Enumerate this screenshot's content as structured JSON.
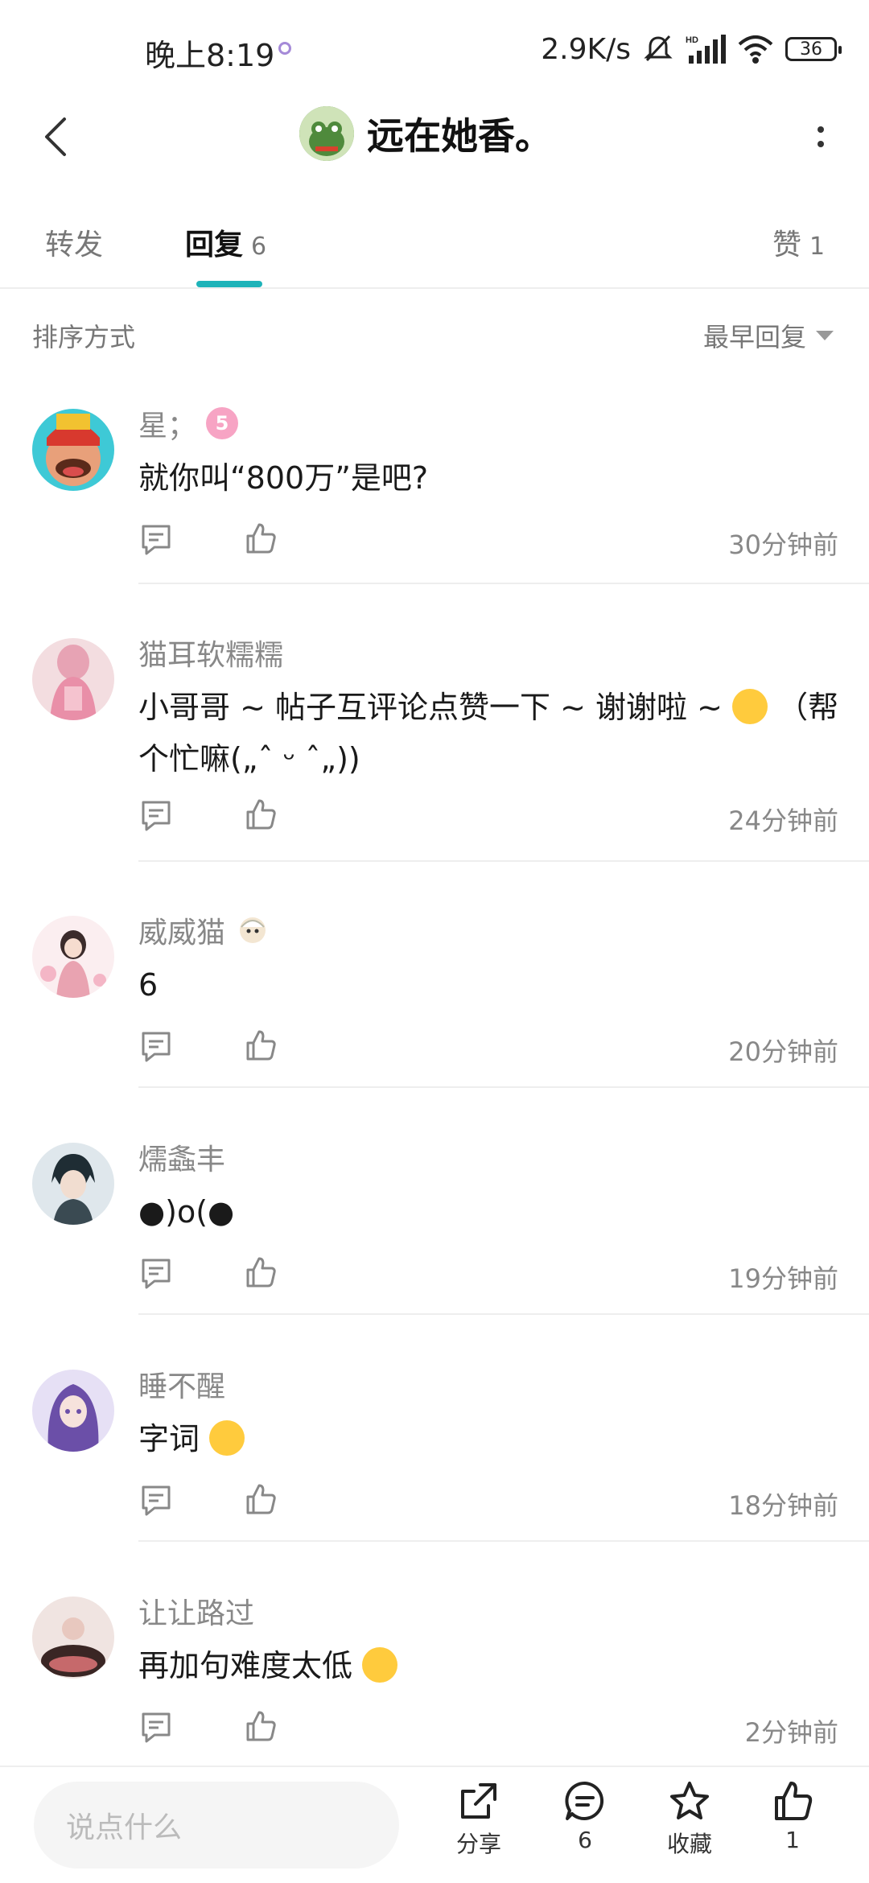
{
  "status_bar": {
    "time": "晚上8:19",
    "net_speed": "2.9K/s",
    "battery": "36"
  },
  "header": {
    "title": "远在她香。"
  },
  "tabs": [
    {
      "label": "转发",
      "count": ""
    },
    {
      "label": "回复",
      "count": "6"
    },
    {
      "label": "赞",
      "count": "1"
    }
  ],
  "sort": {
    "label": "排序方式",
    "value": "最早回复"
  },
  "comments": [
    {
      "user": "星；",
      "text": "就你叫“800万”是吧?",
      "time": "30分钟前",
      "badge": "5"
    },
    {
      "user": "猫耳软糯糯",
      "text_before_emoji": "小哥哥 ~ 帖子互评论点赞一下 ~ 谢谢啦  ~",
      "text_after_emoji": "（帮个忙嘛(„ˆ ᵕ ˆ„))",
      "time": "24分钟前"
    },
    {
      "user": "威威猫",
      "text": "6",
      "time": "20分钟前"
    },
    {
      "user": "燸螽丰",
      "text": "●)o(●",
      "time": "19分钟前"
    },
    {
      "user": "睡不醒",
      "text": "字词",
      "time": "18分钟前"
    },
    {
      "user": "让让路过",
      "text": "再加句难度太低",
      "time": "2分钟前"
    }
  ],
  "bottom_bar": {
    "input_placeholder": "说点什么",
    "share_label": "分享",
    "comment_count": "6",
    "favorite_label": "收藏",
    "like_count": "1"
  },
  "colors": {
    "accent": "#1eb3b9",
    "text_muted": "#888888",
    "divider": "#eeeeee"
  }
}
